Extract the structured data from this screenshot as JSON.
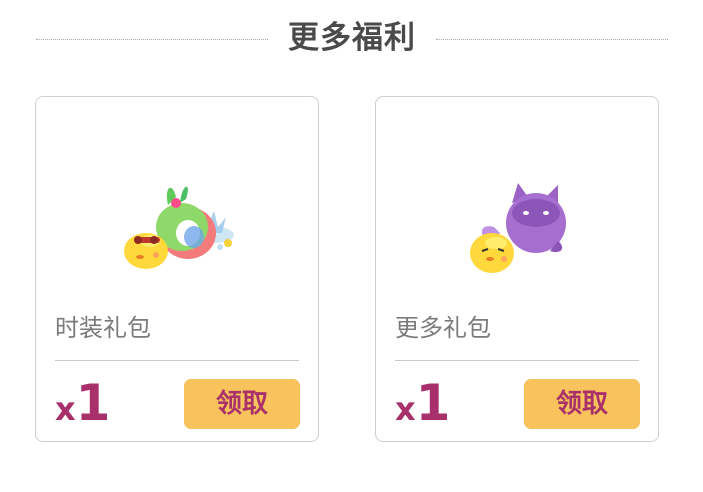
{
  "section": {
    "title": "更多福利"
  },
  "cards": [
    {
      "name": "时装礼包",
      "quantity_prefix": "x",
      "quantity": "1",
      "button_label": "领取"
    },
    {
      "name": "更多礼包",
      "quantity_prefix": "x",
      "quantity": "1",
      "button_label": "领取"
    }
  ],
  "colors": {
    "accent": "#a8316b",
    "button_bg": "#f8c35d",
    "title": "#4a4a4a",
    "muted_text": "#7b7b7b",
    "border": "#d0d0d0"
  }
}
